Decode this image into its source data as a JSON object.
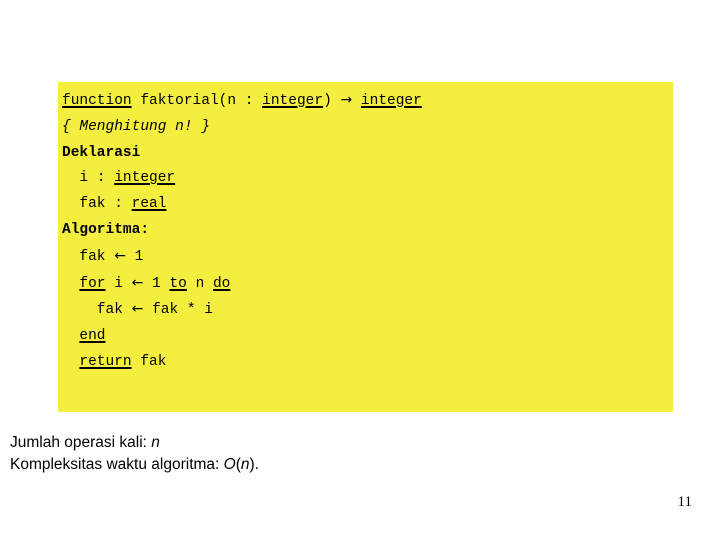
{
  "slide": {
    "page_number": "11",
    "accent_color": "#F4EF3E",
    "text_color": "#000000"
  },
  "code_block": {
    "background": "#F4EF3E",
    "lines": [
      {
        "id": "signature",
        "segments": [
          {
            "text": "function",
            "style": "keyword"
          },
          {
            "text": " faktorial(n : ",
            "style": "plain"
          },
          {
            "text": "integer",
            "style": "keyword"
          },
          {
            "text": ") ",
            "style": "plain"
          },
          {
            "text": "→",
            "style": "arrow"
          },
          {
            "text": " ",
            "style": "plain"
          },
          {
            "text": "integer",
            "style": "keyword"
          }
        ],
        "plain_text": "function faktorial(n : integer) → integer"
      },
      {
        "id": "comment",
        "segments": [
          {
            "text": "{ Menghitung n! }",
            "style": "comment"
          }
        ],
        "plain_text": "{ Menghitung n! }"
      },
      {
        "id": "deklarasi-header",
        "segments": [
          {
            "text": "Deklarasi",
            "style": "bold"
          }
        ],
        "plain_text": "Deklarasi"
      },
      {
        "id": "decl-i",
        "segments": [
          {
            "text": "  i : ",
            "style": "plain"
          },
          {
            "text": "integer",
            "style": "keyword"
          }
        ],
        "plain_text": "  i : integer"
      },
      {
        "id": "decl-fak",
        "segments": [
          {
            "text": "  fak : ",
            "style": "plain"
          },
          {
            "text": "real",
            "style": "keyword"
          }
        ],
        "plain_text": "  fak : real"
      },
      {
        "id": "algoritma-header",
        "segments": [
          {
            "text": "Algoritma:",
            "style": "bold"
          }
        ],
        "plain_text": "Algoritma:"
      },
      {
        "id": "init-fak",
        "segments": [
          {
            "text": "  fak ",
            "style": "plain"
          },
          {
            "text": "←",
            "style": "arrow"
          },
          {
            "text": " 1",
            "style": "plain"
          }
        ],
        "plain_text": "  fak ← 1"
      },
      {
        "id": "for-loop",
        "segments": [
          {
            "text": "  ",
            "style": "plain"
          },
          {
            "text": "for",
            "style": "keyword"
          },
          {
            "text": " i ",
            "style": "plain"
          },
          {
            "text": "←",
            "style": "arrow"
          },
          {
            "text": " 1 ",
            "style": "plain"
          },
          {
            "text": "to",
            "style": "keyword"
          },
          {
            "text": " n ",
            "style": "plain"
          },
          {
            "text": "do",
            "style": "keyword"
          }
        ],
        "plain_text": "  for i ← 1 to n do"
      },
      {
        "id": "loop-body",
        "segments": [
          {
            "text": "    fak ",
            "style": "plain"
          },
          {
            "text": "←",
            "style": "arrow"
          },
          {
            "text": " fak * i",
            "style": "plain"
          }
        ],
        "plain_text": "    fak ← fak * i"
      },
      {
        "id": "end-loop",
        "segments": [
          {
            "text": "  ",
            "style": "plain"
          },
          {
            "text": "end",
            "style": "keyword"
          }
        ],
        "plain_text": "  end"
      },
      {
        "id": "return",
        "segments": [
          {
            "text": "  ",
            "style": "plain"
          },
          {
            "text": "return",
            "style": "keyword"
          },
          {
            "text": " fak",
            "style": "plain"
          }
        ],
        "plain_text": "  return fak"
      }
    ]
  },
  "notes": {
    "lines": [
      {
        "id": "jumlah-operasi",
        "segments": [
          {
            "text": "Jumlah operasi kali: ",
            "style": "plain"
          },
          {
            "text": "n",
            "style": "italic"
          }
        ],
        "plain_text": "Jumlah operasi kali: n"
      },
      {
        "id": "kompleksitas",
        "segments": [
          {
            "text": "Kompleksitas waktu algoritma: ",
            "style": "plain"
          },
          {
            "text": "O",
            "style": "italic"
          },
          {
            "text": "(",
            "style": "plain"
          },
          {
            "text": "n",
            "style": "italic"
          },
          {
            "text": ").",
            "style": "plain"
          }
        ],
        "plain_text": "Kompleksitas waktu algoritma: O(n)."
      }
    ]
  }
}
